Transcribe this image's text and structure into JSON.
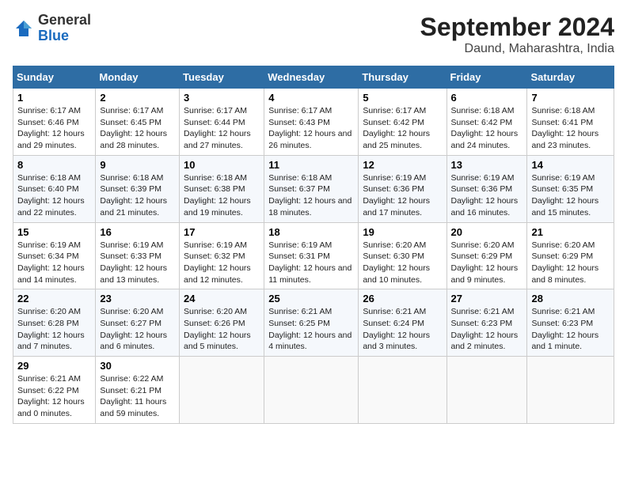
{
  "logo": {
    "general": "General",
    "blue": "Blue"
  },
  "title": "September 2024",
  "subtitle": "Daund, Maharashtra, India",
  "days_of_week": [
    "Sunday",
    "Monday",
    "Tuesday",
    "Wednesday",
    "Thursday",
    "Friday",
    "Saturday"
  ],
  "weeks": [
    [
      {
        "day": 1,
        "sunrise": "6:17 AM",
        "sunset": "6:46 PM",
        "daylight": "12 hours and 29 minutes."
      },
      {
        "day": 2,
        "sunrise": "6:17 AM",
        "sunset": "6:45 PM",
        "daylight": "12 hours and 28 minutes."
      },
      {
        "day": 3,
        "sunrise": "6:17 AM",
        "sunset": "6:44 PM",
        "daylight": "12 hours and 27 minutes."
      },
      {
        "day": 4,
        "sunrise": "6:17 AM",
        "sunset": "6:43 PM",
        "daylight": "12 hours and 26 minutes."
      },
      {
        "day": 5,
        "sunrise": "6:17 AM",
        "sunset": "6:42 PM",
        "daylight": "12 hours and 25 minutes."
      },
      {
        "day": 6,
        "sunrise": "6:18 AM",
        "sunset": "6:42 PM",
        "daylight": "12 hours and 24 minutes."
      },
      {
        "day": 7,
        "sunrise": "6:18 AM",
        "sunset": "6:41 PM",
        "daylight": "12 hours and 23 minutes."
      }
    ],
    [
      {
        "day": 8,
        "sunrise": "6:18 AM",
        "sunset": "6:40 PM",
        "daylight": "12 hours and 22 minutes."
      },
      {
        "day": 9,
        "sunrise": "6:18 AM",
        "sunset": "6:39 PM",
        "daylight": "12 hours and 21 minutes."
      },
      {
        "day": 10,
        "sunrise": "6:18 AM",
        "sunset": "6:38 PM",
        "daylight": "12 hours and 19 minutes."
      },
      {
        "day": 11,
        "sunrise": "6:18 AM",
        "sunset": "6:37 PM",
        "daylight": "12 hours and 18 minutes."
      },
      {
        "day": 12,
        "sunrise": "6:19 AM",
        "sunset": "6:36 PM",
        "daylight": "12 hours and 17 minutes."
      },
      {
        "day": 13,
        "sunrise": "6:19 AM",
        "sunset": "6:36 PM",
        "daylight": "12 hours and 16 minutes."
      },
      {
        "day": 14,
        "sunrise": "6:19 AM",
        "sunset": "6:35 PM",
        "daylight": "12 hours and 15 minutes."
      }
    ],
    [
      {
        "day": 15,
        "sunrise": "6:19 AM",
        "sunset": "6:34 PM",
        "daylight": "12 hours and 14 minutes."
      },
      {
        "day": 16,
        "sunrise": "6:19 AM",
        "sunset": "6:33 PM",
        "daylight": "12 hours and 13 minutes."
      },
      {
        "day": 17,
        "sunrise": "6:19 AM",
        "sunset": "6:32 PM",
        "daylight": "12 hours and 12 minutes."
      },
      {
        "day": 18,
        "sunrise": "6:19 AM",
        "sunset": "6:31 PM",
        "daylight": "12 hours and 11 minutes."
      },
      {
        "day": 19,
        "sunrise": "6:20 AM",
        "sunset": "6:30 PM",
        "daylight": "12 hours and 10 minutes."
      },
      {
        "day": 20,
        "sunrise": "6:20 AM",
        "sunset": "6:29 PM",
        "daylight": "12 hours and 9 minutes."
      },
      {
        "day": 21,
        "sunrise": "6:20 AM",
        "sunset": "6:29 PM",
        "daylight": "12 hours and 8 minutes."
      }
    ],
    [
      {
        "day": 22,
        "sunrise": "6:20 AM",
        "sunset": "6:28 PM",
        "daylight": "12 hours and 7 minutes."
      },
      {
        "day": 23,
        "sunrise": "6:20 AM",
        "sunset": "6:27 PM",
        "daylight": "12 hours and 6 minutes."
      },
      {
        "day": 24,
        "sunrise": "6:20 AM",
        "sunset": "6:26 PM",
        "daylight": "12 hours and 5 minutes."
      },
      {
        "day": 25,
        "sunrise": "6:21 AM",
        "sunset": "6:25 PM",
        "daylight": "12 hours and 4 minutes."
      },
      {
        "day": 26,
        "sunrise": "6:21 AM",
        "sunset": "6:24 PM",
        "daylight": "12 hours and 3 minutes."
      },
      {
        "day": 27,
        "sunrise": "6:21 AM",
        "sunset": "6:23 PM",
        "daylight": "12 hours and 2 minutes."
      },
      {
        "day": 28,
        "sunrise": "6:21 AM",
        "sunset": "6:23 PM",
        "daylight": "12 hours and 1 minute."
      }
    ],
    [
      {
        "day": 29,
        "sunrise": "6:21 AM",
        "sunset": "6:22 PM",
        "daylight": "12 hours and 0 minutes."
      },
      {
        "day": 30,
        "sunrise": "6:22 AM",
        "sunset": "6:21 PM",
        "daylight": "11 hours and 59 minutes."
      },
      null,
      null,
      null,
      null,
      null
    ]
  ]
}
